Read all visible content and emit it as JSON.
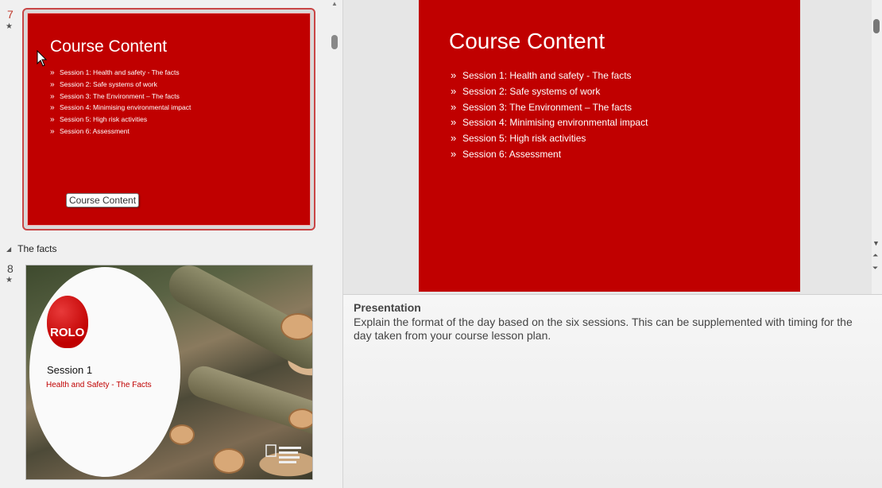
{
  "thumbnails": {
    "slide7": {
      "number": "7",
      "star": "★",
      "title": "Course Content",
      "items": [
        "Session 1: Health and safety - The facts",
        "Session 2: Safe systems of work",
        "Session 3: The Environment – The facts",
        "Session 4: Minimising environmental impact",
        "Session 5: High risk activities",
        "Session 6: Assessment"
      ],
      "tooltip": "Course Content"
    },
    "section": {
      "label": "The facts"
    },
    "slide8": {
      "number": "8",
      "star": "★",
      "logo_text": "ROLO",
      "session": "Session 1",
      "subtitle": "Health and Safety - The Facts"
    }
  },
  "slide": {
    "title": "Course Content",
    "bullet_glyph": "»",
    "items": [
      "Session 1: Health and safety - The facts",
      "Session 2: Safe systems of work",
      "Session 3: The Environment – The facts",
      "Session 4: Minimising environmental impact",
      "Session 5: High risk activities",
      "Session 6: Assessment"
    ],
    "background_color": "#c00000"
  },
  "notes": {
    "title": "Presentation",
    "body": "Explain the format of the day based on the six sessions. This can be supplemented with timing for the day taken from your course lesson plan."
  }
}
